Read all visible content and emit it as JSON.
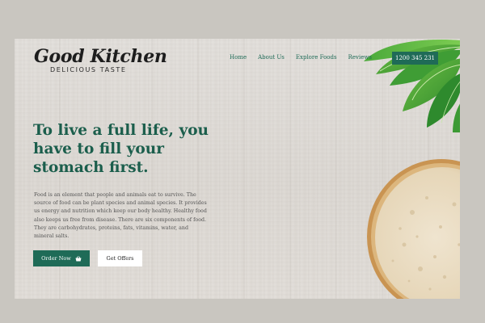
{
  "brand": {
    "name": "Good Kitchen",
    "tagline": "DELICIOUS TASTE"
  },
  "nav": {
    "items": [
      "Home",
      "About Us",
      "Explore Foods",
      "Reviews"
    ]
  },
  "phone": "1200 345 231",
  "hero": {
    "headline": "To live a full life, you have to fill your stomach first.",
    "body": "Food is an element that people and animals eat to survive. The source of food can be plant species and animal species. It provides us energy and nutrition which keep our body healthy. Healthy food also keeps us free from disease. There are six components of food. They are carbohydrates, proteins, fats, vitamins, water, and mineral salts.",
    "primary_button": "Order Now",
    "primary_button_icon": "basket-icon",
    "secondary_button": "Get Offers"
  },
  "colors": {
    "accent": "#1f6b57",
    "headline": "#1b5e4c",
    "frame": "#c9c6c0"
  }
}
